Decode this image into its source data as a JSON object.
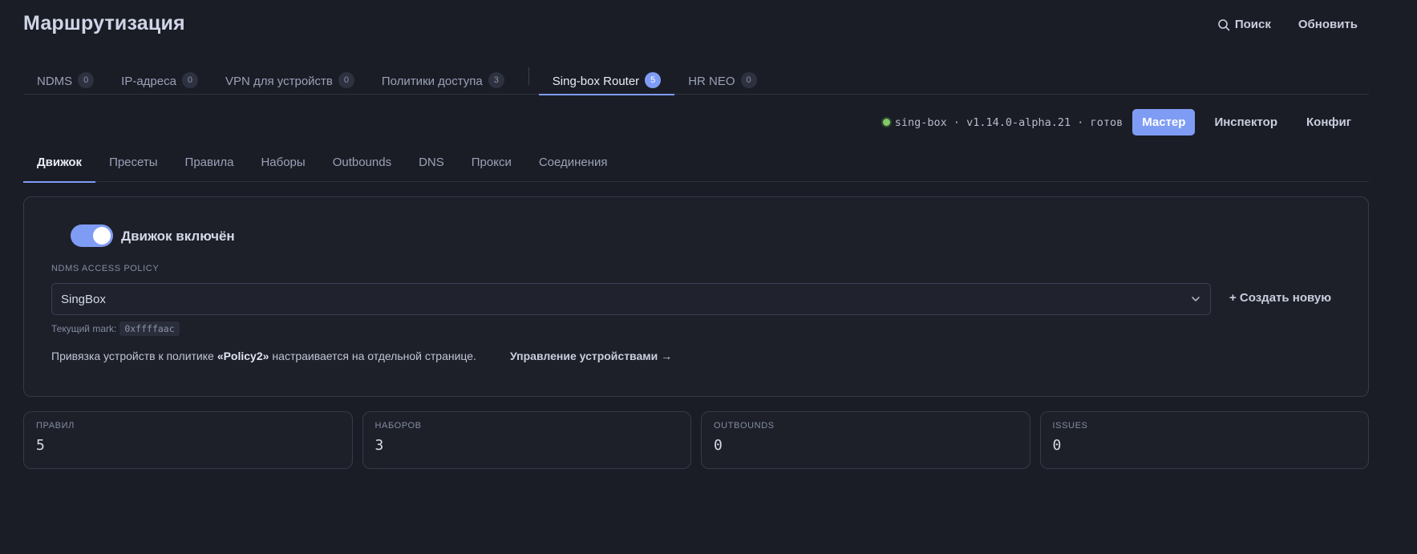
{
  "header": {
    "title": "Маршрутизация",
    "search_label": "Поиск",
    "refresh_label": "Обновить"
  },
  "top_tabs": [
    {
      "label": "NDMS",
      "count": "0"
    },
    {
      "label": "IP-адреса",
      "count": "0"
    },
    {
      "label": "VPN для устройств",
      "count": "0"
    },
    {
      "label": "Политики доступа",
      "count": "3"
    },
    {
      "label": "Sing-box Router",
      "count": "5",
      "active": true
    },
    {
      "label": "HR NEO",
      "count": "0"
    }
  ],
  "status": {
    "text": "sing-box · v1.14.0-alpha.21 · готов",
    "indicator_color": "#84c86a"
  },
  "mode_buttons": {
    "master": "Мастер",
    "inspector": "Инспектор",
    "config": "Конфиг"
  },
  "sub_tabs": [
    {
      "label": "Движок",
      "active": true
    },
    {
      "label": "Пресеты"
    },
    {
      "label": "Правила"
    },
    {
      "label": "Наборы"
    },
    {
      "label": "Outbounds"
    },
    {
      "label": "DNS"
    },
    {
      "label": "Прокси"
    },
    {
      "label": "Соединения"
    }
  ],
  "engine": {
    "toggle_label": "Движок включён",
    "toggle_on": true,
    "policy_label": "NDMS ACCESS POLICY",
    "policy_value": "SingBox",
    "create_new": "+ Создать новую",
    "mark_label": "Текущий mark:",
    "mark_value": "0xffffaac",
    "binding_prefix": "Привязка устройств к политике",
    "binding_policy": "«Policy2»",
    "binding_suffix": "настраивается на отдельной странице.",
    "manage_link": "Управление устройствами →"
  },
  "stats": [
    {
      "label": "ПРАВИЛ",
      "value": "5"
    },
    {
      "label": "НАБОРОВ",
      "value": "3"
    },
    {
      "label": "OUTBOUNDS",
      "value": "0"
    },
    {
      "label": "ISSUES",
      "value": "0"
    }
  ],
  "colors": {
    "background": "#1b1d26",
    "accent": "#7f9cf5"
  }
}
